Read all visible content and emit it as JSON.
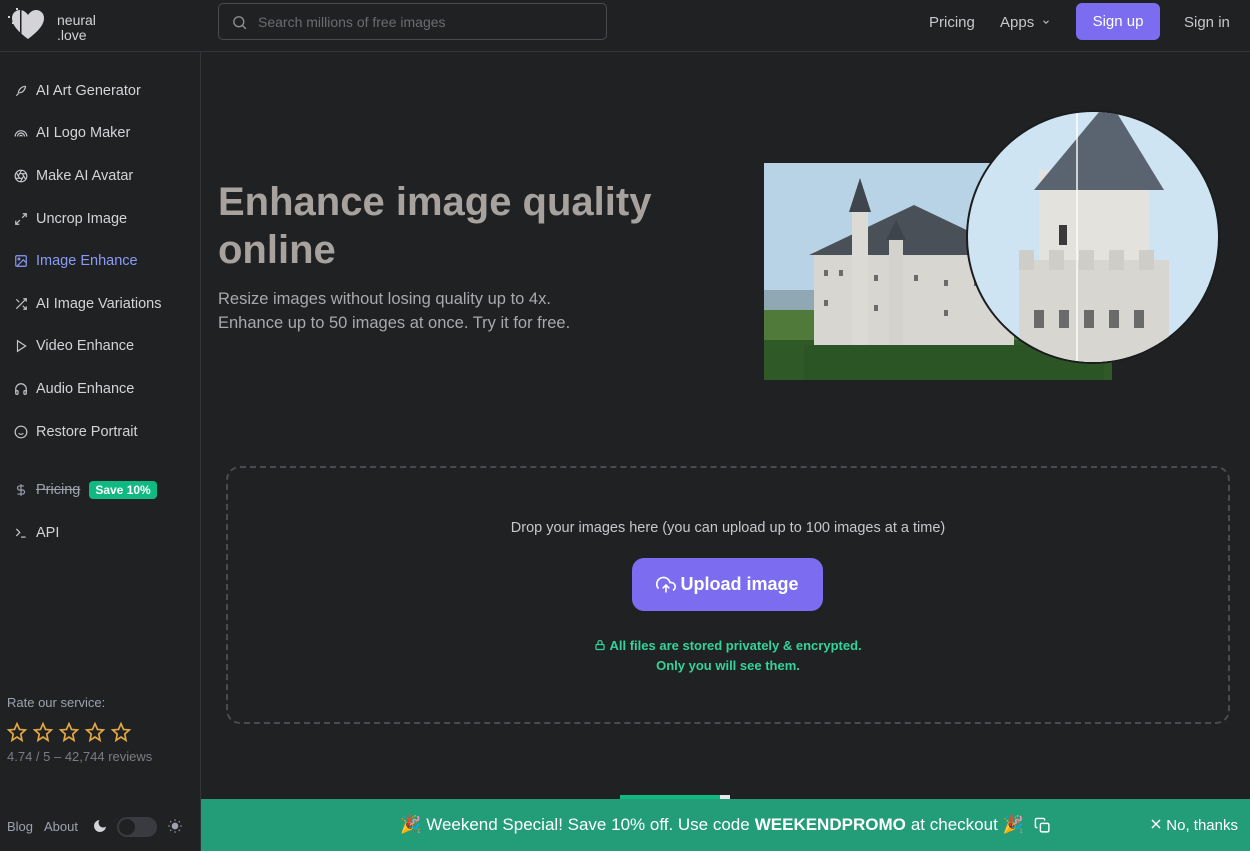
{
  "header": {
    "logo_line1": "neural",
    "logo_line2": ".love",
    "search_placeholder": "Search millions of free images",
    "nav": {
      "pricing": "Pricing",
      "apps": "Apps",
      "signup": "Sign up",
      "signin": "Sign in"
    }
  },
  "sidebar": {
    "items": [
      {
        "label": "AI Art Generator",
        "icon": "feather-icon"
      },
      {
        "label": "AI Logo Maker",
        "icon": "rainbow-icon"
      },
      {
        "label": "Make AI Avatar",
        "icon": "aperture-icon"
      },
      {
        "label": "Uncrop Image",
        "icon": "expand-icon"
      },
      {
        "label": "Image Enhance",
        "icon": "image-icon",
        "active": true
      },
      {
        "label": "AI Image Variations",
        "icon": "shuffle-icon"
      },
      {
        "label": "Video Enhance",
        "icon": "play-icon"
      },
      {
        "label": "Audio Enhance",
        "icon": "headphones-icon"
      },
      {
        "label": "Restore Portrait",
        "icon": "smile-icon"
      }
    ],
    "pricing_label": "Pricing",
    "pricing_badge": "Save 10%",
    "api_label": "API",
    "rate_label": "Rate our service:",
    "star_count": 5,
    "rating_text": "4.74 / 5 – 42,744 reviews",
    "footer": {
      "blog": "Blog",
      "about": "About"
    }
  },
  "hero": {
    "title": "Enhance image quality online",
    "subtitle_line1": "Resize images without losing quality up to 4x.",
    "subtitle_line2": "Enhance up to 50 images at once. Try it for free."
  },
  "upload": {
    "drop_text": "Drop your images here (you can upload up to 100 images at a time)",
    "button_label": "Upload image",
    "secure_line1": "All files are stored privately & encrypted.",
    "secure_line2": "Only you will see them."
  },
  "promo": {
    "text_before": "🎉 Weekend Special! Save 10% off. Use code",
    "code": "WEEKENDPROMO",
    "text_after": "at checkout 🎉",
    "dismiss": "No, thanks"
  },
  "colors": {
    "accent": "#7c6cf0",
    "promo_bg": "#239d78",
    "secure_text": "#34d399",
    "background": "#202123"
  }
}
